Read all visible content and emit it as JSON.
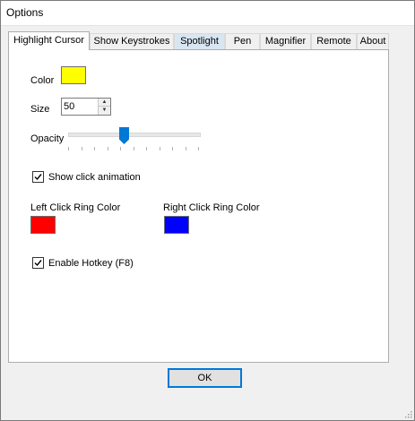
{
  "window": {
    "title": "Options"
  },
  "tabs": [
    {
      "label": "Highlight Cursor",
      "active": true
    },
    {
      "label": "Show Keystrokes"
    },
    {
      "label": "Spotlight"
    },
    {
      "label": "Pen"
    },
    {
      "label": "Magnifier"
    },
    {
      "label": "Remote"
    },
    {
      "label": "About"
    }
  ],
  "highlight": {
    "color_label": "Color",
    "color_value": "#ffff00",
    "size_label": "Size",
    "size_value": "50",
    "opacity_label": "Opacity",
    "opacity_fraction": 0.42,
    "show_click_animation": {
      "label": "Show click animation",
      "checked": true
    },
    "left_ring": {
      "label": "Left Click Ring Color",
      "color": "#ff0000"
    },
    "right_ring": {
      "label": "Right Click Ring Color",
      "color": "#0000ff"
    },
    "enable_hotkey": {
      "label": "Enable Hotkey (F8)",
      "checked": true
    }
  },
  "buttons": {
    "ok_label": "OK"
  },
  "colors": {
    "accent": "#0078d7"
  }
}
